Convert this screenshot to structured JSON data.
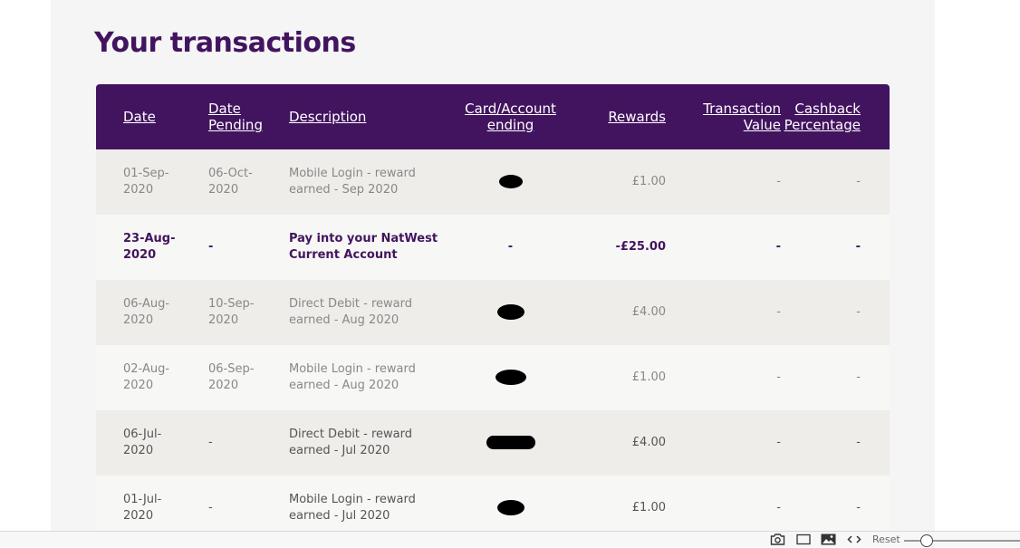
{
  "page": {
    "title": "Your transactions"
  },
  "colors": {
    "brand_purple": "#42145f",
    "row_odd": "#eeedea",
    "row_even": "#f7f7f5"
  },
  "table": {
    "headers": {
      "date": "Date",
      "date_pending_1": "Date",
      "date_pending_2": "Pending",
      "description": "Description",
      "card_1": "Card/Account",
      "card_2": "ending",
      "rewards": "Rewards",
      "value_1": "Transaction",
      "value_2": "Value",
      "cashback_1": "Cashback",
      "cashback_2": "Percentage"
    },
    "rows": [
      {
        "date_1": "01-Sep-",
        "date_2": "2020",
        "pending_1": "06-Oct-",
        "pending_2": "2020",
        "desc_1": "Mobile Login - reward",
        "desc_2": "earned - Sep 2020",
        "card": "",
        "rewards": "£1.00",
        "value": "-",
        "cashback": "-"
      },
      {
        "date_1": "23-Aug-",
        "date_2": "2020",
        "pending_1": "-",
        "pending_2": "",
        "desc_1": "Pay into your NatWest",
        "desc_2": "Current Account",
        "card": "-",
        "rewards": "-£25.00",
        "value": "-",
        "cashback": "-"
      },
      {
        "date_1": "06-Aug-",
        "date_2": "2020",
        "pending_1": "10-Sep-",
        "pending_2": "2020",
        "desc_1": "Direct Debit - reward",
        "desc_2": "earned - Aug 2020",
        "card": "",
        "rewards": "£4.00",
        "value": "-",
        "cashback": "-"
      },
      {
        "date_1": "02-Aug-",
        "date_2": "2020",
        "pending_1": "06-Sep-",
        "pending_2": "2020",
        "desc_1": "Mobile Login - reward",
        "desc_2": "earned - Aug 2020",
        "card": "",
        "rewards": "£1.00",
        "value": "-",
        "cashback": "-"
      },
      {
        "date_1": "06-Jul-",
        "date_2": "2020",
        "pending_1": "-",
        "pending_2": "",
        "desc_1": "Direct Debit - reward",
        "desc_2": "earned - Jul 2020",
        "card": "",
        "rewards": "£4.00",
        "value": "-",
        "cashback": "-"
      },
      {
        "date_1": "01-Jul-",
        "date_2": "2020",
        "pending_1": "-",
        "pending_2": "",
        "desc_1": "Mobile Login - reward",
        "desc_2": "earned - Jul 2020",
        "card": "",
        "rewards": "£1.00",
        "value": "-",
        "cashback": "-"
      }
    ]
  },
  "toolbar": {
    "icons": [
      "camera-icon",
      "frame-icon",
      "image-icon",
      "code-icon"
    ],
    "reset_label": "Reset",
    "zoom_level": 0.14
  }
}
